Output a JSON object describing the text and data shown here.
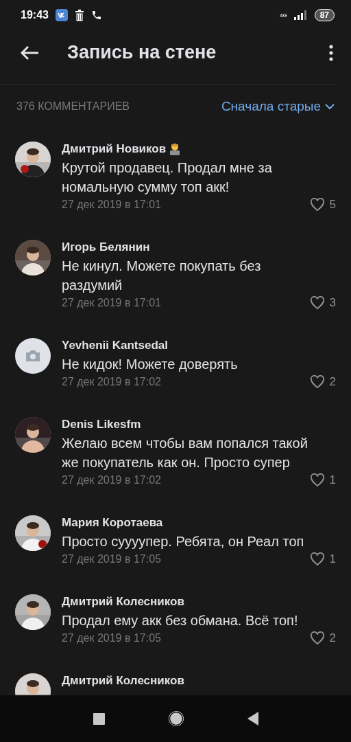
{
  "status_bar": {
    "time": "19:43",
    "network": "4G",
    "battery": "87"
  },
  "header": {
    "title": "Запись на стене"
  },
  "comments_bar": {
    "count": "376 КОММЕНТАРИЕВ",
    "sort": "Сначала старые"
  },
  "comments": [
    {
      "author": "Дмитрий Новиков",
      "badge_icon": true,
      "has_photo": true,
      "text": "Крутой продавец. Продал мне за номальную сумму топ акк!",
      "date": "27 дек 2019 в 17:01",
      "likes": "5",
      "liked": false
    },
    {
      "author": "Игорь Белянин",
      "badge_icon": false,
      "has_photo": true,
      "text": "Не кинул. Можете покупать без раздумий",
      "date": "27 дек 2019 в 17:01",
      "likes": "3",
      "liked": false
    },
    {
      "author": "Yevhenii Kantsedal",
      "badge_icon": false,
      "has_photo": false,
      "text": "Не кидок! Можете доверять",
      "date": "27 дек 2019 в 17:02",
      "likes": "2",
      "liked": false
    },
    {
      "author": "Denis Likesfm",
      "badge_icon": false,
      "has_photo": true,
      "text": "Желаю всем чтобы вам попался такой же покупатель как он. Просто супер",
      "date": "27 дек 2019 в 17:02",
      "likes": "1",
      "liked": false
    },
    {
      "author": "Мария Коротаева",
      "badge_icon": false,
      "has_photo": true,
      "text": "Просто суууупер. Ребята, он Реал топ",
      "date": "27 дек 2019 в 17:05",
      "likes": "1",
      "liked": false
    },
    {
      "author": "Дмитрий Колесников",
      "badge_icon": false,
      "has_photo": true,
      "text": "Продал ему акк без обмана. Всё топ!",
      "date": "27 дек 2019 в 17:05",
      "likes": "2",
      "liked": false
    },
    {
      "author": "Дмитрий Колесников",
      "badge_icon": false,
      "has_photo": true
    }
  ]
}
